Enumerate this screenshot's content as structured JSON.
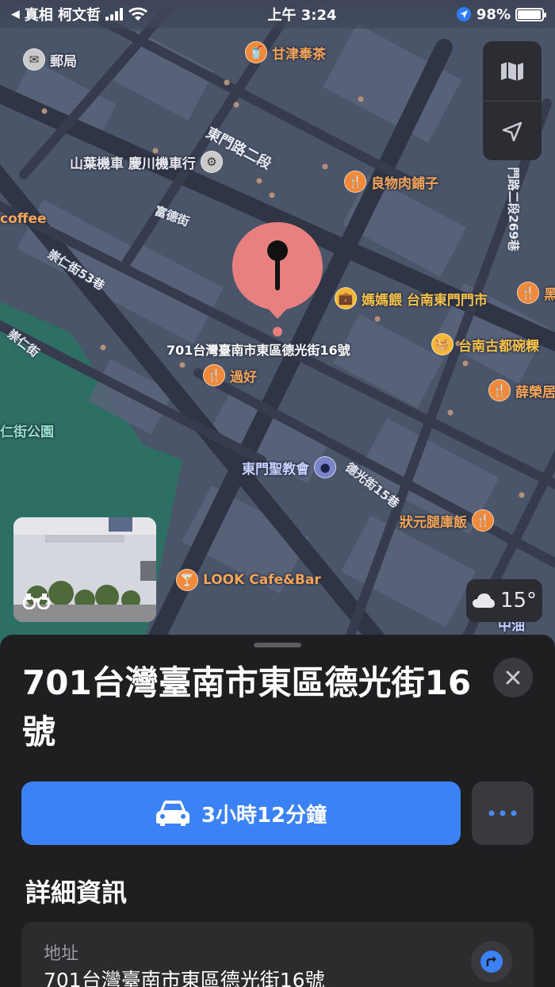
{
  "status_bar": {
    "back_app": "真相 柯文哲",
    "time": "上午 3:24",
    "battery_percent": "98%",
    "signal_bars": 4,
    "battery_level": 0.98
  },
  "map": {
    "pois": [
      {
        "id": "post-office",
        "label": "郵局",
        "icon": "envelope-icon",
        "style": "gray"
      },
      {
        "id": "ganjin-tea",
        "label": "甘津奉茶",
        "icon": "cup-icon",
        "style": "orange"
      },
      {
        "id": "motor-shop",
        "label": "山葉機車 慶川機車行",
        "icon": "motorcycle-icon",
        "style": "gray"
      },
      {
        "id": "butcher",
        "label": "良物肉鋪子",
        "icon": "fork-knife-icon",
        "style": "orange"
      },
      {
        "id": "coffee",
        "label": "coffee",
        "icon": "",
        "style": "orange"
      },
      {
        "id": "mama-shop",
        "label": "媽媽餵 台南東門門市",
        "icon": "bag-icon",
        "style": "yellow"
      },
      {
        "id": "bowl-rice",
        "label": "台南古都碗粿",
        "icon": "basket-icon",
        "style": "yellow"
      },
      {
        "id": "guohao",
        "label": "過好",
        "icon": "fork-knife-icon",
        "style": "orange"
      },
      {
        "id": "xue-rong",
        "label": "薛榮居",
        "icon": "fork-knife-icon",
        "style": "orange"
      },
      {
        "id": "church",
        "label": "東門聖教會",
        "icon": "church-icon",
        "style": "navy"
      },
      {
        "id": "zhuangyuan",
        "label": "狀元腿庫飯",
        "icon": "fork-knife-icon",
        "style": "orange"
      },
      {
        "id": "look-cafe",
        "label": "LOOK Cafe&Bar",
        "icon": "cocktail-icon",
        "style": "orange"
      },
      {
        "id": "park",
        "label": "仁街公園",
        "icon": "",
        "style": "green"
      },
      {
        "id": "black-food",
        "label": "黑",
        "icon": "fork-knife-icon",
        "style": "orange"
      },
      {
        "id": "gas",
        "label": "中油",
        "icon": "",
        "style": "blue"
      }
    ],
    "streets": [
      {
        "id": "dongmen-rd-2",
        "label": "東門路二段"
      },
      {
        "id": "fude-st",
        "label": "富德街"
      },
      {
        "id": "chongren-53",
        "label": "崇仁街53巷"
      },
      {
        "id": "chongren",
        "label": "崇仁街"
      },
      {
        "id": "deguang-15",
        "label": "德光街15巷"
      },
      {
        "id": "dongmen-269",
        "label": "門路二段269巷"
      }
    ],
    "pin_address": "701台灣臺南市東區德光街16號",
    "weather": "15°",
    "weather_icon": "cloud-icon"
  },
  "sheet": {
    "title": "701台灣臺南市東區德光街16號",
    "directions_label": "3小時12分鐘",
    "details_heading": "詳細資訊",
    "address_label": "地址",
    "address_value": "701台灣臺南市東區德光街16號"
  },
  "colors": {
    "accent_blue": "#3a82f6",
    "pin_red": "#e88080",
    "poi_orange": "#f08a3a",
    "sheet_bg": "#1f1f21"
  }
}
